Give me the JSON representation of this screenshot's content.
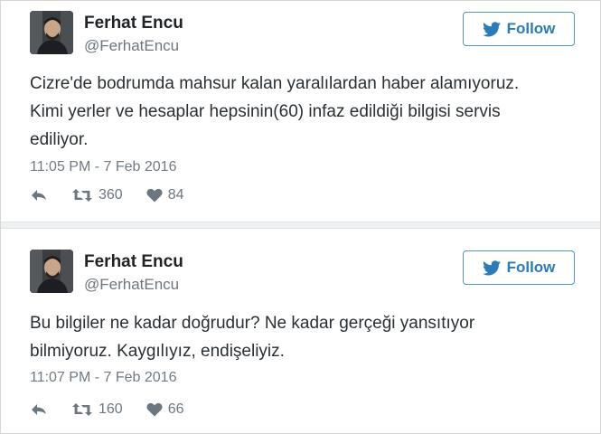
{
  "tweets": [
    {
      "name": "Ferhat Encu",
      "handle": "@FerhatEncu",
      "follow_label": "Follow",
      "text_lines": [
        "Cizre'de bodrumda mahsur kalan yaralılardan haber alamıyoruz.",
        "Kimi yerler ve hesaplar hepsinin(60) infaz edildiği bilgisi servis",
        "ediliyor."
      ],
      "time": "11:05 PM - 7 Feb 2016",
      "retweets": "360",
      "likes": "84"
    },
    {
      "name": "Ferhat Encu",
      "handle": "@FerhatEncu",
      "follow_label": "Follow",
      "text_lines": [
        "Bu bilgiler ne kadar doğrudur? Ne kadar gerçeği yansıtıyor",
        "bilmiyoruz. Kaygılıyız, endişeliyiz."
      ],
      "time": "11:07 PM - 7 Feb 2016",
      "retweets": "160",
      "likes": "66"
    }
  ],
  "icons": {
    "reply": "reply-icon",
    "retweet": "retweet-icon",
    "like": "heart-icon",
    "follow": "bird-icon"
  },
  "colors": {
    "accent": "#2b7bb9",
    "muted": "#6b7780",
    "text": "#292f33"
  }
}
